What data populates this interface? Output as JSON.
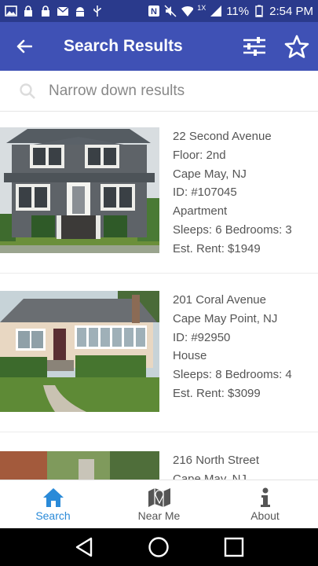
{
  "status_bar": {
    "battery": "11%",
    "time": "2:54 PM",
    "network": "1X"
  },
  "app_bar": {
    "title": "Search Results"
  },
  "search": {
    "placeholder": "Narrow down results",
    "value": ""
  },
  "results": [
    {
      "lines": [
        "22 Second Avenue",
        "Floor: 2nd",
        "Cape May, NJ",
        "ID: #107045",
        "Apartment",
        "Sleeps: 6 Bedrooms: 3",
        "Est. Rent: $1949"
      ]
    },
    {
      "lines": [
        "201 Coral Avenue",
        "Cape May Point, NJ",
        "ID: #92950",
        "House",
        "Sleeps: 8 Bedrooms: 4",
        "Est. Rent: $3099"
      ]
    },
    {
      "lines": [
        "216 North Street",
        "Cape May, NJ"
      ]
    }
  ],
  "bottom_nav": [
    {
      "label": "Search",
      "icon": "home-icon",
      "active": true
    },
    {
      "label": "Near Me",
      "icon": "map-icon",
      "active": false
    },
    {
      "label": "About",
      "icon": "info-icon",
      "active": false
    }
  ],
  "colors": {
    "status_bar": "#2a3a8c",
    "app_bar": "#3f51b5",
    "active_nav": "#2a8ad8"
  }
}
